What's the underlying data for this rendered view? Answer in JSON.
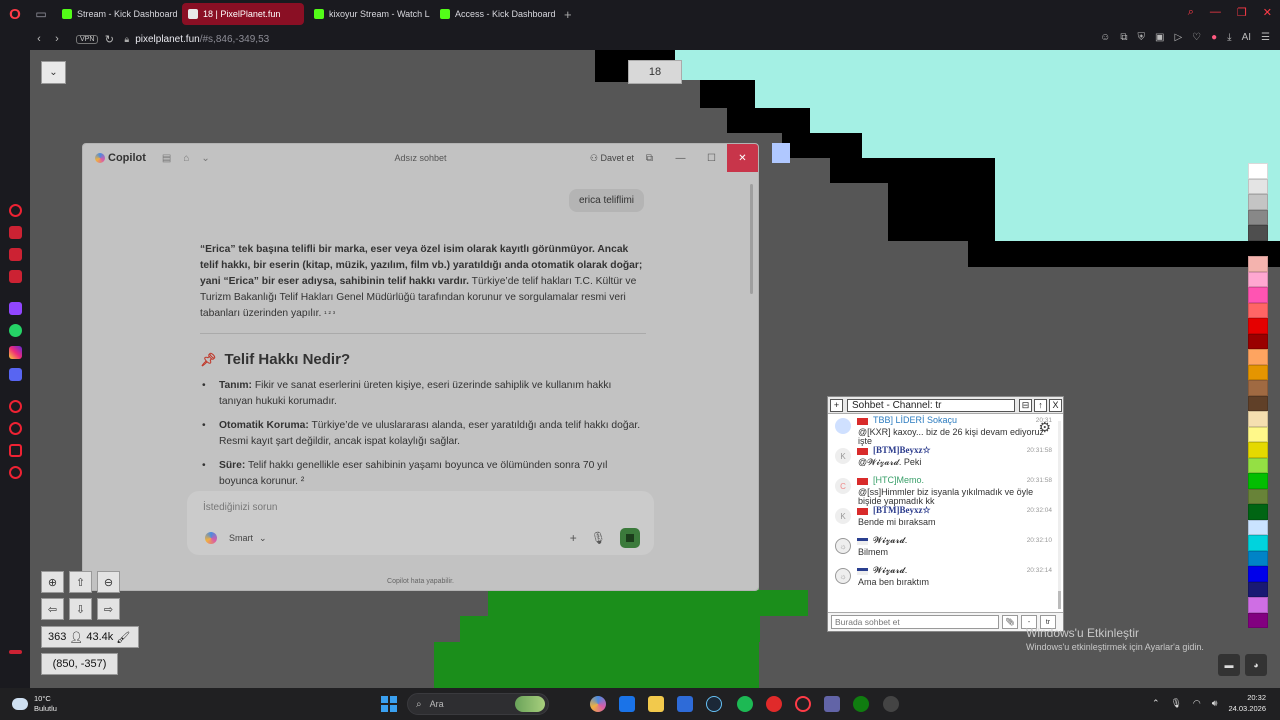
{
  "browser": {
    "tabs": [
      {
        "label": "Stream - Kick Dashboard",
        "icon": "kick-icon",
        "active": false
      },
      {
        "label": "18 | PixelPlanet.fun",
        "icon": "pixelplanet-icon",
        "active": true
      },
      {
        "label": "kixoyur Stream - Watch Li...",
        "icon": "kick-icon",
        "active": false
      },
      {
        "label": "Access - Kick Dashboard",
        "icon": "kick-icon",
        "active": false
      }
    ],
    "new_tab": "+",
    "vpn": "VPN",
    "url_host": "pixelplanet.fun",
    "url_rest": "/#s,846,-349,53",
    "ai_label": "AI"
  },
  "canvas": {
    "dropdown_glyph": "⌄",
    "online_counter": "18",
    "zoom_in": "⊕",
    "zoom_out": "⊖",
    "up": "⇧",
    "down": "⇩",
    "left": "⇦",
    "right": "⇨",
    "online_users": "363",
    "pixels_placed": "43.4k",
    "coordinates": "(850, -357)"
  },
  "copilot": {
    "logo": "Copilot",
    "title": "Adsız sohbet",
    "invite": "Davet et",
    "user_message": "erica teliflimi",
    "answer_bold": "“Erica” tek başına telifli bir marka, eser veya özel isim olarak kayıtlı görünmüyor. Ancak telif hakkı, bir eserin (kitap, müzik, yazılım, film vb.) yaratıldığı anda otomatik olarak doğar; yani “Erica” bir eser adıysa, sahibinin telif hakkı vardır.",
    "answer_normal": "Türkiye’de telif hakları T.C. Kültür ve Turizm Bakanlığı Telif Hakları Genel Müdürlüğü tarafından korunur ve sorgulamalar resmi veri tabanları üzerinden yapılır.",
    "citations": "¹ ² ³",
    "heading": "Telif Hakkı Nedir?",
    "bullets": [
      {
        "term": "Tanım:",
        "text": "Fikir ve sanat eserlerini üreten kişiye, eseri üzerinde sahiplik ve kullanım hakkı tanıyan hukuki korumadır."
      },
      {
        "term": "Otomatik Koruma:",
        "text": "Türkiye’de ve uluslararası alanda, eser yaratıldığı anda telif hakkı doğar. Resmi kayıt şart değildir, ancak ispat kolaylığı sağlar."
      },
      {
        "term": "Süre:",
        "text": "Telif hakkı genellikle eser sahibinin yaşamı boyunca ve ölümünden sonra 70 yıl boyunca korunur. ²"
      }
    ],
    "input_placeholder": "İstediğinizi sorun",
    "mode": "Smart",
    "footer": "Copilot hata yapabilir."
  },
  "chat": {
    "title": "Sohbet - Channel: tr",
    "input_placeholder": "Burada sohbet et",
    "channel_btn": "tr",
    "messages": [
      {
        "name": "TBB] LİDERİ Sokaçu",
        "time": "20:31",
        "line1": "@[KXR] kaxoy... biz de 26 kişi devam ediyoruz",
        "line2": "işte",
        "name_color": "#2b7bbf"
      },
      {
        "name": "[BTM]Beyxz☆",
        "time": "20:31:58",
        "line1": "@𝓦𝓲𝔃𝓪𝓻𝓭. Peki",
        "line2": "",
        "name_color": "#2b3b8c"
      },
      {
        "name": "[HTC]Memo.",
        "time": "20:31:58",
        "line1": "@[ss]Himmler biz isyanla yıkılmadık ve öyle",
        "line2": "bişide yapmadık kk",
        "name_color": "#3aa06a"
      },
      {
        "name": "[BTM]Beyxz☆",
        "time": "20:32:04",
        "line1": "Bende mi bıraksam",
        "line2": "",
        "name_color": "#2b3b8c"
      },
      {
        "name": "𝓦𝓲𝔃𝓪𝓻𝓭.",
        "time": "20:32:10",
        "line1": "Bilmem",
        "line2": "",
        "name_color": "#222"
      },
      {
        "name": "𝓦𝓲𝔃𝓪𝓻𝓭.",
        "time": "20:32:14",
        "line1": "Ama ben bıraktım",
        "line2": "",
        "name_color": "#222"
      }
    ]
  },
  "activation": {
    "line1": "Windows'u Etkinleştir",
    "line2": "Windows'u etkinleştirmek için Ayarlar'a gidin."
  },
  "palette": [
    "#ffffff",
    "#e4e4e4",
    "#c4c4c4",
    "#888888",
    "#4e4e4e",
    "#000000",
    "#f4b3ae",
    "#ffa7d1",
    "#ff54b2",
    "#ff6565",
    "#e50000",
    "#9a0000",
    "#fea460",
    "#e59500",
    "#a06a42",
    "#604028",
    "#f5dfb0",
    "#fff889",
    "#e5d900",
    "#94e044",
    "#02be01",
    "#688338",
    "#006513",
    "#cae3ff",
    "#00d3dd",
    "#0083c7",
    "#0000ea",
    "#191973",
    "#cf6ee4",
    "#820080"
  ],
  "taskbar": {
    "temperature": "10°C",
    "condition": "Bulutlu",
    "search": "Ara",
    "time": "20:32",
    "date": "24.03.2026"
  }
}
